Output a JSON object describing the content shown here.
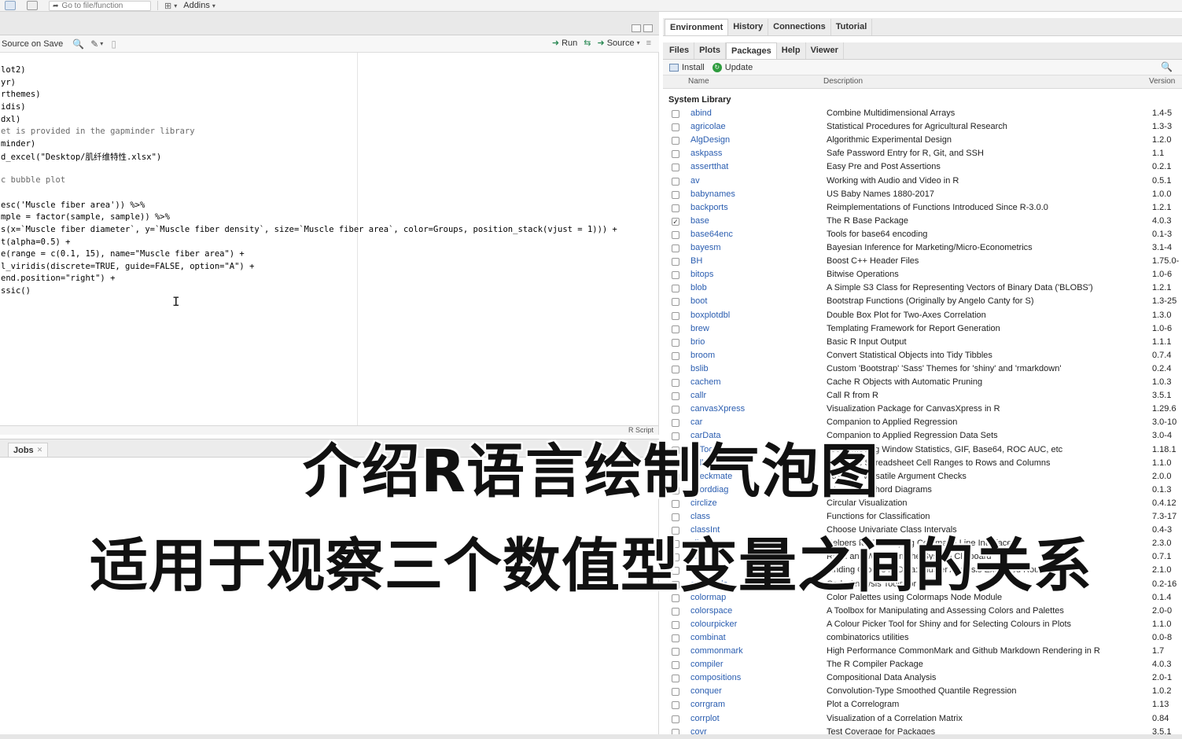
{
  "toolbar": {
    "goto_placeholder": "Go to file/function",
    "addins_label": "Addins"
  },
  "editor": {
    "source_on_save": "Source on Save",
    "run_label": "Run",
    "source_label": "Source",
    "filetype": "R Script",
    "lines": [
      "lot2)",
      "yr)",
      "rthemes)",
      "idis)",
      "dxl)",
      "et is provided in the gapminder library",
      "minder)",
      "d_excel(\"Desktop/肌纤维特性.xlsx\")",
      "",
      "c bubble plot",
      "",
      "esc('Muscle fiber area')) %>%",
      "mple = factor(sample, sample)) %>%",
      "s(x=`Muscle fiber diameter`, y=`Muscle fiber density`, size=`Muscle fiber area`, color=Groups, position_stack(vjust = 1))) +",
      "t(alpha=0.5) +",
      "e(range = c(0.1, 15), name=\"Muscle fiber area\") +",
      "l_viridis(discrete=TRUE, guide=FALSE, option=\"A\") +",
      "end.position=\"right\") +",
      "ssic()"
    ]
  },
  "console": {
    "jobs_tab": "Jobs"
  },
  "env_tabs": [
    "Environment",
    "History",
    "Connections",
    "Tutorial"
  ],
  "files_tabs": [
    "Files",
    "Plots",
    "Packages",
    "Help",
    "Viewer"
  ],
  "files_active": "Packages",
  "packages": {
    "install_label": "Install",
    "update_label": "Update",
    "col_name": "Name",
    "col_description": "Description",
    "col_version": "Version",
    "section": "System Library",
    "rows": [
      {
        "name": "abind",
        "desc": "Combine Multidimensional Arrays",
        "ver": "1.4-5",
        "checked": false
      },
      {
        "name": "agricolae",
        "desc": "Statistical Procedures for Agricultural Research",
        "ver": "1.3-3",
        "checked": false
      },
      {
        "name": "AlgDesign",
        "desc": "Algorithmic Experimental Design",
        "ver": "1.2.0",
        "checked": false
      },
      {
        "name": "askpass",
        "desc": "Safe Password Entry for R, Git, and SSH",
        "ver": "1.1",
        "checked": false
      },
      {
        "name": "assertthat",
        "desc": "Easy Pre and Post Assertions",
        "ver": "0.2.1",
        "checked": false
      },
      {
        "name": "av",
        "desc": "Working with Audio and Video in R",
        "ver": "0.5.1",
        "checked": false
      },
      {
        "name": "babynames",
        "desc": "US Baby Names 1880-2017",
        "ver": "1.0.0",
        "checked": false
      },
      {
        "name": "backports",
        "desc": "Reimplementations of Functions Introduced Since R-3.0.0",
        "ver": "1.2.1",
        "checked": false
      },
      {
        "name": "base",
        "desc": "The R Base Package",
        "ver": "4.0.3",
        "checked": true
      },
      {
        "name": "base64enc",
        "desc": "Tools for base64 encoding",
        "ver": "0.1-3",
        "checked": false
      },
      {
        "name": "bayesm",
        "desc": "Bayesian Inference for Marketing/Micro-Econometrics",
        "ver": "3.1-4",
        "checked": false
      },
      {
        "name": "BH",
        "desc": "Boost C++ Header Files",
        "ver": "1.75.0-",
        "checked": false
      },
      {
        "name": "bitops",
        "desc": "Bitwise Operations",
        "ver": "1.0-6",
        "checked": false
      },
      {
        "name": "blob",
        "desc": "A Simple S3 Class for Representing Vectors of Binary Data ('BLOBS')",
        "ver": "1.2.1",
        "checked": false
      },
      {
        "name": "boot",
        "desc": "Bootstrap Functions (Originally by Angelo Canty for S)",
        "ver": "1.3-25",
        "checked": false
      },
      {
        "name": "boxplotdbl",
        "desc": "Double Box Plot for Two-Axes Correlation",
        "ver": "1.3.0",
        "checked": false
      },
      {
        "name": "brew",
        "desc": "Templating Framework for Report Generation",
        "ver": "1.0-6",
        "checked": false
      },
      {
        "name": "brio",
        "desc": "Basic R Input Output",
        "ver": "1.1.1",
        "checked": false
      },
      {
        "name": "broom",
        "desc": "Convert Statistical Objects into Tidy Tibbles",
        "ver": "0.7.4",
        "checked": false
      },
      {
        "name": "bslib",
        "desc": "Custom 'Bootstrap' 'Sass' Themes for 'shiny' and 'rmarkdown'",
        "ver": "0.2.4",
        "checked": false
      },
      {
        "name": "cachem",
        "desc": "Cache R Objects with Automatic Pruning",
        "ver": "1.0.3",
        "checked": false
      },
      {
        "name": "callr",
        "desc": "Call R from R",
        "ver": "3.5.1",
        "checked": false
      },
      {
        "name": "canvasXpress",
        "desc": "Visualization Package for CanvasXpress in R",
        "ver": "1.29.6",
        "checked": false
      },
      {
        "name": "car",
        "desc": "Companion to Applied Regression",
        "ver": "3.0-10",
        "checked": false
      },
      {
        "name": "carData",
        "desc": "Companion to Applied Regression Data Sets",
        "ver": "3.0-4",
        "checked": false
      },
      {
        "name": "caTools",
        "desc": "Tools: Moving Window Statistics, GIF, Base64, ROC AUC, etc",
        "ver": "1.18.1",
        "checked": false
      },
      {
        "name": "cellranger",
        "desc": "Translate Spreadsheet Cell Ranges to Rows and Columns",
        "ver": "1.1.0",
        "checked": false
      },
      {
        "name": "checkmate",
        "desc": "Fast and Versatile Argument Checks",
        "ver": "2.0.0",
        "checked": false
      },
      {
        "name": "chorddiag",
        "desc": "Interactive Chord Diagrams",
        "ver": "0.1.3",
        "checked": false
      },
      {
        "name": "circlize",
        "desc": "Circular Visualization",
        "ver": "0.4.12",
        "checked": false
      },
      {
        "name": "class",
        "desc": "Functions for Classification",
        "ver": "7.3-17",
        "checked": false
      },
      {
        "name": "classInt",
        "desc": "Choose Univariate Class Intervals",
        "ver": "0.4-3",
        "checked": false
      },
      {
        "name": "cli",
        "desc": "Helpers for Developing Command Line Interfaces",
        "ver": "2.3.0",
        "checked": false
      },
      {
        "name": "clipr",
        "desc": "Read and Write from the System Clipboard",
        "ver": "0.7.1",
        "checked": false
      },
      {
        "name": "cluster",
        "desc": "Finding Groups in Data: Cluster Analysis Extended Rousseeuw et al.",
        "ver": "2.1.0",
        "checked": false
      },
      {
        "name": "codetools",
        "desc": "Code Analysis Tools for R",
        "ver": "0.2-16",
        "checked": false
      },
      {
        "name": "colormap",
        "desc": "Color Palettes using Colormaps Node Module",
        "ver": "0.1.4",
        "checked": false
      },
      {
        "name": "colorspace",
        "desc": "A Toolbox for Manipulating and Assessing Colors and Palettes",
        "ver": "2.0-0",
        "checked": false
      },
      {
        "name": "colourpicker",
        "desc": "A Colour Picker Tool for Shiny and for Selecting Colours in Plots",
        "ver": "1.1.0",
        "checked": false
      },
      {
        "name": "combinat",
        "desc": "combinatorics utilities",
        "ver": "0.0-8",
        "checked": false
      },
      {
        "name": "commonmark",
        "desc": "High Performance CommonMark and Github Markdown Rendering in R",
        "ver": "1.7",
        "checked": false
      },
      {
        "name": "compiler",
        "desc": "The R Compiler Package",
        "ver": "4.0.3",
        "checked": false
      },
      {
        "name": "compositions",
        "desc": "Compositional Data Analysis",
        "ver": "2.0-1",
        "checked": false
      },
      {
        "name": "conquer",
        "desc": "Convolution-Type Smoothed Quantile Regression",
        "ver": "1.0.2",
        "checked": false
      },
      {
        "name": "corrgram",
        "desc": "Plot a Correlogram",
        "ver": "1.13",
        "checked": false
      },
      {
        "name": "corrplot",
        "desc": "Visualization of a Correlation Matrix",
        "ver": "0.84",
        "checked": false
      },
      {
        "name": "covr",
        "desc": "Test Coverage for Packages",
        "ver": "3.5.1",
        "checked": false
      }
    ]
  },
  "overlay": {
    "line1": "介绍R语言绘制气泡图",
    "line2": "适用于观察三个数值型变量之间的关系"
  },
  "colors": {
    "package_link": "#2a5db0",
    "string": "#037a0e",
    "number": "#0000ff"
  }
}
